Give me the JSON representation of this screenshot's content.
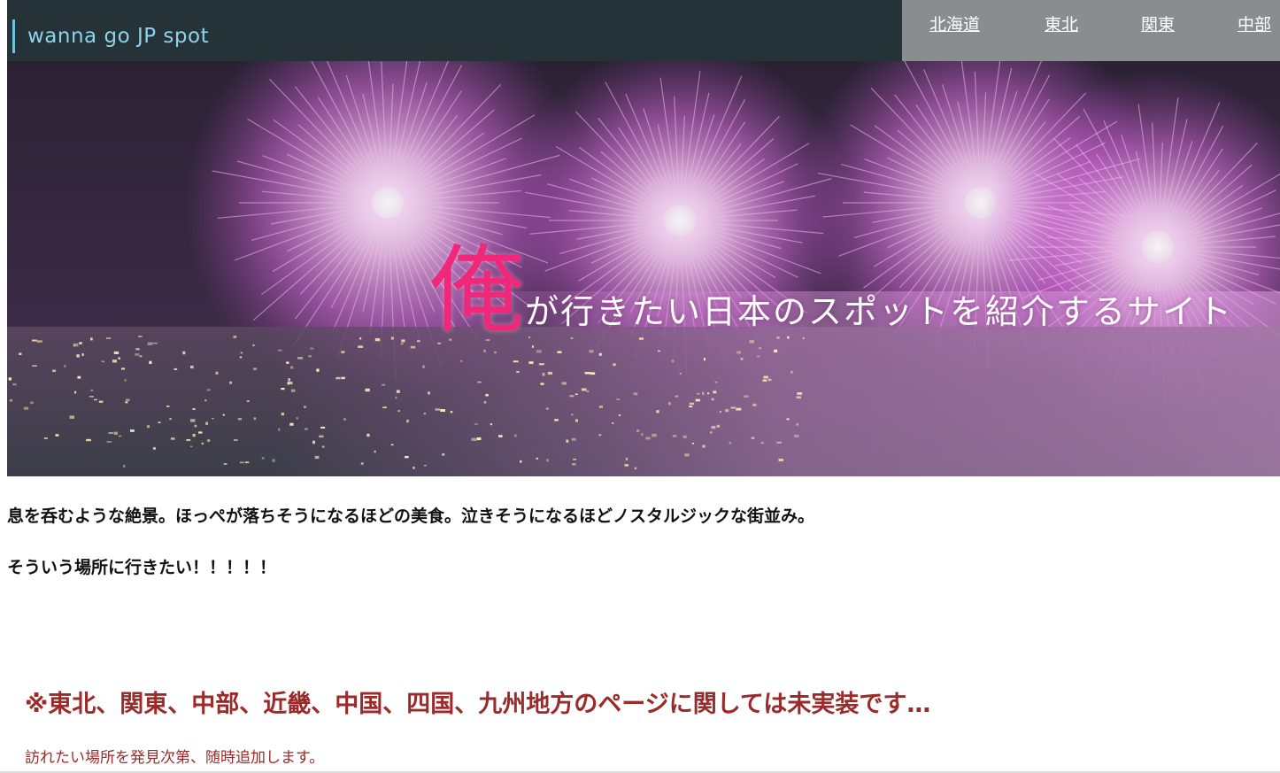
{
  "header": {
    "logo": "wanna go JP spot",
    "nav": [
      {
        "label": "北海道"
      },
      {
        "label": "東北"
      },
      {
        "label": "関東"
      },
      {
        "label": "中部"
      }
    ]
  },
  "hero": {
    "title_big": "俺",
    "title_rest": "が行きたい日本のスポットを紹介するサイト"
  },
  "main": {
    "intro_line1": "息を呑むような絶景。ほっぺが落ちそうになるほどの美食。泣きそうになるほどノスタルジックな街並み。",
    "intro_line2": "そういう場所に行きたい！！！！！",
    "notice": "※東北、関東、中部、近畿、中国、四国、九州地方のページに関しては未実装です…",
    "notice_sub": "訪れたい場所を発見次第、随時追加します。"
  },
  "colors": {
    "header_dark": "#253238",
    "header_nav": "#8a8d8f",
    "logo_accent": "#8fd3ea",
    "hero_accent": "#f0287a",
    "notice": "#9b2a2a"
  }
}
